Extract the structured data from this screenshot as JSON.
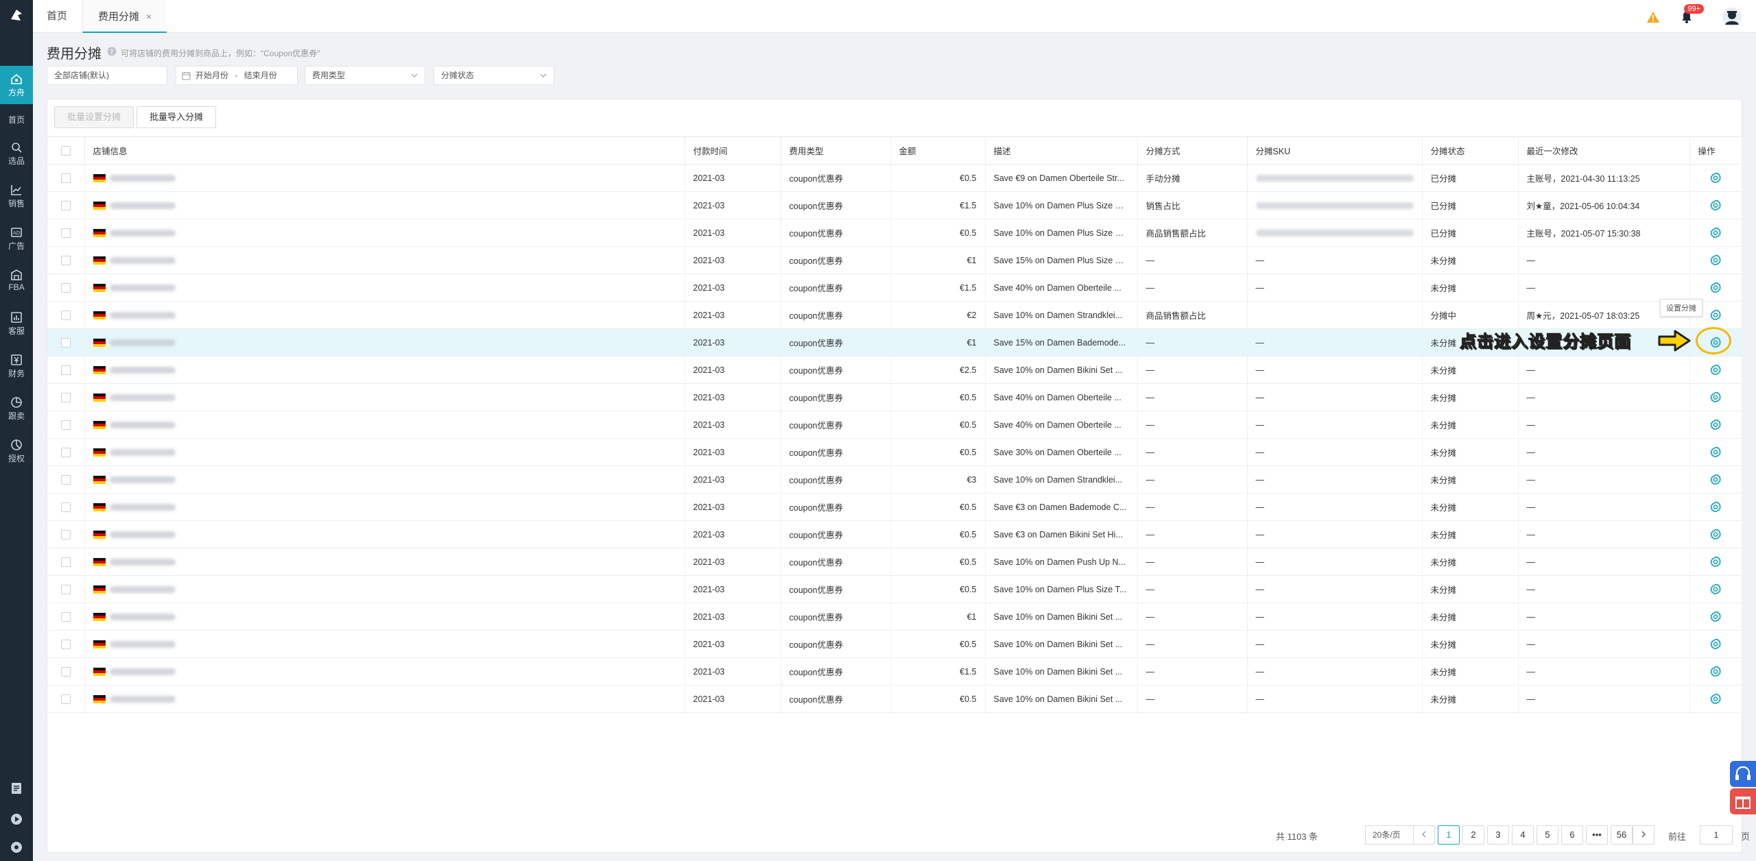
{
  "topbar": {
    "tabs": [
      {
        "label": "首页"
      },
      {
        "label": "费用分摊",
        "close": "×"
      }
    ],
    "notification_badge": "99+"
  },
  "sidebar": {
    "items": [
      {
        "label": "方舟",
        "icon": "home-ark-icon"
      },
      {
        "label": "首页",
        "icon": "none"
      },
      {
        "label": "选品",
        "icon": "search-icon"
      },
      {
        "label": "销售",
        "icon": "chart-line-icon"
      },
      {
        "label": "广告",
        "icon": "ad-icon"
      },
      {
        "label": "FBA",
        "icon": "warehouse-icon"
      },
      {
        "label": "客服",
        "icon": "bar-chart-icon"
      },
      {
        "label": "财务",
        "icon": "finance-icon"
      },
      {
        "label": "跟卖",
        "icon": "pie-icon"
      },
      {
        "label": "授权",
        "icon": "pie-icon"
      }
    ]
  },
  "page": {
    "title": "费用分摊",
    "hint": "可将店铺的费用分摊到商品上，例如：\"Coupon优惠券\"",
    "filters": {
      "store": "全部店铺(默认)",
      "month_start": "开始月份",
      "month_sep": "-",
      "month_end": "结束月份",
      "fee_type": "费用类型",
      "status": "分摊状态"
    },
    "buttons": {
      "batch_set": "批量设置分摊",
      "batch_import": "批量导入分摊"
    }
  },
  "table": {
    "headers": [
      "店铺信息",
      "付款时间",
      "费用类型",
      "金额",
      "描述",
      "分摊方式",
      "分摊SKU",
      "分摊状态",
      "最近一次修改",
      "操作"
    ],
    "rows": [
      {
        "time": "2021-03",
        "type": "coupon优惠券",
        "amount": "€0.5",
        "desc": "Save €9 on Damen Oberteile Str...",
        "method": "手动分摊",
        "sku": "blurred",
        "status": "已分摊",
        "modified": "主账号，2021-04-30 11:13:25"
      },
      {
        "time": "2021-03",
        "type": "coupon优惠券",
        "amount": "€1.5",
        "desc": "Save 10% on Damen Plus Size Fl...",
        "method": "销售占比",
        "sku": "blurred",
        "status": "已分摊",
        "modified": "刘★童，2021-05-06 10:04:34"
      },
      {
        "time": "2021-03",
        "type": "coupon优惠券",
        "amount": "€0.5",
        "desc": "Save 10% on Damen Plus Size Fl...",
        "method": "商品销售额占比",
        "sku": "blurred",
        "status": "已分摊",
        "modified": "主账号，2021-05-07 15:30:38"
      },
      {
        "time": "2021-03",
        "type": "coupon优惠券",
        "amount": "€1",
        "desc": "Save 15% on Damen Plus Size Fl...",
        "method": "—",
        "sku": "—",
        "status": "未分摊",
        "modified": "—"
      },
      {
        "time": "2021-03",
        "type": "coupon优惠券",
        "amount": "€1.5",
        "desc": "Save 40% on Damen Oberteile ...",
        "method": "—",
        "sku": "—",
        "status": "未分摊",
        "modified": "—"
      },
      {
        "time": "2021-03",
        "type": "coupon优惠券",
        "amount": "€2",
        "desc": "Save 10% on Damen Strandklei...",
        "method": "商品销售额占比",
        "sku": "",
        "status": "分摊中",
        "modified": "周★元，2021-05-07 18:03:25"
      },
      {
        "time": "2021-03",
        "type": "coupon优惠券",
        "amount": "€1",
        "desc": "Save 15% on Damen Bademode...",
        "method": "—",
        "sku": "—",
        "status": "未分摊",
        "modified": ""
      },
      {
        "time": "2021-03",
        "type": "coupon优惠券",
        "amount": "€2.5",
        "desc": "Save 10% on Damen Bikini Set ...",
        "method": "—",
        "sku": "—",
        "status": "未分摊",
        "modified": "—"
      },
      {
        "time": "2021-03",
        "type": "coupon优惠券",
        "amount": "€0.5",
        "desc": "Save 40% on Damen Oberteile ...",
        "method": "—",
        "sku": "—",
        "status": "未分摊",
        "modified": "—"
      },
      {
        "time": "2021-03",
        "type": "coupon优惠券",
        "amount": "€0.5",
        "desc": "Save 40% on Damen Oberteile ...",
        "method": "—",
        "sku": "—",
        "status": "未分摊",
        "modified": "—"
      },
      {
        "time": "2021-03",
        "type": "coupon优惠券",
        "amount": "€0.5",
        "desc": "Save 30% on Damen Oberteile ...",
        "method": "—",
        "sku": "—",
        "status": "未分摊",
        "modified": "—"
      },
      {
        "time": "2021-03",
        "type": "coupon优惠券",
        "amount": "€3",
        "desc": "Save 10% on Damen Strandklei...",
        "method": "—",
        "sku": "—",
        "status": "未分摊",
        "modified": "—"
      },
      {
        "time": "2021-03",
        "type": "coupon优惠券",
        "amount": "€0.5",
        "desc": "Save €3 on Damen Bademode C...",
        "method": "—",
        "sku": "—",
        "status": "未分摊",
        "modified": "—"
      },
      {
        "time": "2021-03",
        "type": "coupon优惠券",
        "amount": "€0.5",
        "desc": "Save €3 on Damen Bikini Set Hi...",
        "method": "—",
        "sku": "—",
        "status": "未分摊",
        "modified": "—"
      },
      {
        "time": "2021-03",
        "type": "coupon优惠券",
        "amount": "€0.5",
        "desc": "Save 10% on Damen Push Up N...",
        "method": "—",
        "sku": "—",
        "status": "未分摊",
        "modified": "—"
      },
      {
        "time": "2021-03",
        "type": "coupon优惠券",
        "amount": "€0.5",
        "desc": "Save 10% on Damen Plus Size T...",
        "method": "—",
        "sku": "—",
        "status": "未分摊",
        "modified": "—"
      },
      {
        "time": "2021-03",
        "type": "coupon优惠券",
        "amount": "€1",
        "desc": "Save 10% on Damen Bikini Set ...",
        "method": "—",
        "sku": "—",
        "status": "未分摊",
        "modified": "—"
      },
      {
        "time": "2021-03",
        "type": "coupon优惠券",
        "amount": "€0.5",
        "desc": "Save 10% on Damen Bikini Set ...",
        "method": "—",
        "sku": "—",
        "status": "未分摊",
        "modified": "—"
      },
      {
        "time": "2021-03",
        "type": "coupon优惠券",
        "amount": "€1.5",
        "desc": "Save 10% on Damen Bikini Set ...",
        "method": "—",
        "sku": "—",
        "status": "未分摊",
        "modified": "—"
      },
      {
        "time": "2021-03",
        "type": "coupon优惠券",
        "amount": "€0.5",
        "desc": "Save 10% on Damen Bikini Set ...",
        "method": "—",
        "sku": "—",
        "status": "未分摊",
        "modified": "—"
      }
    ],
    "highlight_row": 6
  },
  "tooltip": "设置分摊",
  "callout": "点击进入设置分摊页面",
  "pagination": {
    "total": "共 1103 条",
    "page_size": "20条/页",
    "pages": [
      "1",
      "2",
      "3",
      "4",
      "5",
      "6",
      "•••",
      "56"
    ],
    "goto_label": "前往",
    "goto_value": "1",
    "page_suffix": "页"
  },
  "colors": {
    "accent": "#1aa3b8",
    "sidebar_bg": "#1e2a36",
    "callout": "#ffd400",
    "float_blue": "#2f6fdb",
    "float_red": "#e8504a"
  }
}
